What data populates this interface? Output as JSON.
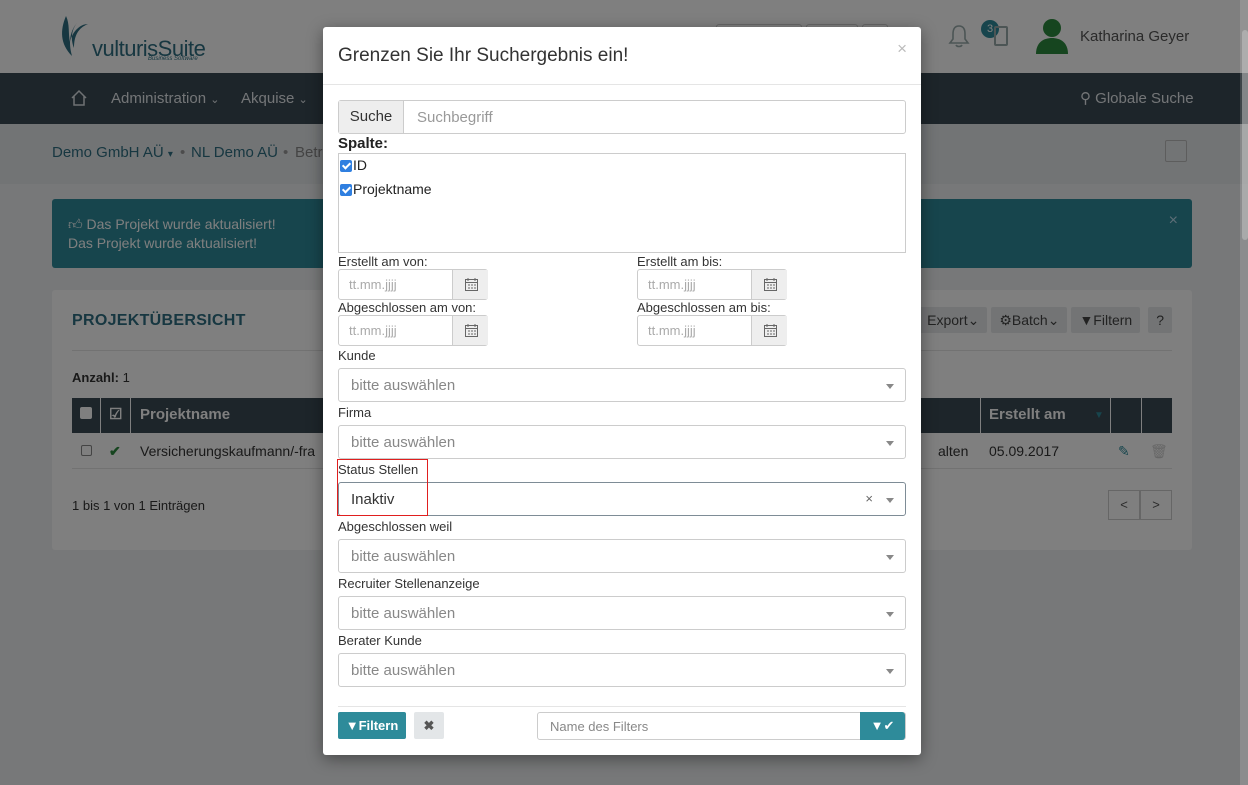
{
  "app": {
    "logo_text": "vulturisSuite",
    "logo_sub": "Business Software",
    "notification_count": "3",
    "user_name": "Katharina Geyer"
  },
  "nav": {
    "items": [
      "Administration",
      "Akquise"
    ],
    "global_search": "Globale Suche"
  },
  "breadcrumb": {
    "items": [
      "Demo GmbH AÜ",
      "NL Demo AÜ",
      "Betr"
    ]
  },
  "alert": {
    "line1": "Das Projekt wurde aktualisiert!",
    "line2": "Das Projekt wurde aktualisiert!"
  },
  "panel": {
    "title": "PROJEKTÜBERSICHT",
    "tools": [
      "Export",
      "Batch",
      "Filtern",
      "?"
    ],
    "count_label": "Anzahl:",
    "count_value": "1",
    "columns": [
      "Projektname",
      "Erstellt am"
    ],
    "row": {
      "projektname": "Versicherungskaufmann/-fra",
      "status_partial": "alten",
      "erstellt": "05.09.2017"
    },
    "info": "1 bis 1 von 1 Einträgen",
    "pager": [
      "<",
      ">"
    ]
  },
  "modal": {
    "title": "Grenzen Sie Ihr Suchergebnis ein!",
    "close": "×",
    "search_addon": "Suche",
    "search_placeholder": "Suchbegriff",
    "columns_label": "Spalte:",
    "columns": [
      "ID",
      "Projektname"
    ],
    "dates": {
      "created_from": "Erstellt am von:",
      "created_to": "Erstellt am bis:",
      "closed_from": "Abgeschlossen am von:",
      "closed_to": "Abgeschlossen am bis:",
      "placeholder": "tt.mm.jjjj"
    },
    "selects": [
      {
        "label": "Kunde",
        "value": "bitte auswählen"
      },
      {
        "label": "Firma",
        "value": "bitte auswählen"
      },
      {
        "label": "Status Stellen",
        "value": "Inaktiv"
      },
      {
        "label": "Abgeschlossen weil",
        "value": "bitte auswählen"
      },
      {
        "label": "Recruiter Stellenanzeige",
        "value": "bitte auswählen"
      },
      {
        "label": "Berater Kunde",
        "value": "bitte auswählen"
      }
    ],
    "clear_symbol": "×",
    "filter_button": "Filtern",
    "reset_symbol": "✖",
    "filter_name_placeholder": "Name des Filters"
  }
}
